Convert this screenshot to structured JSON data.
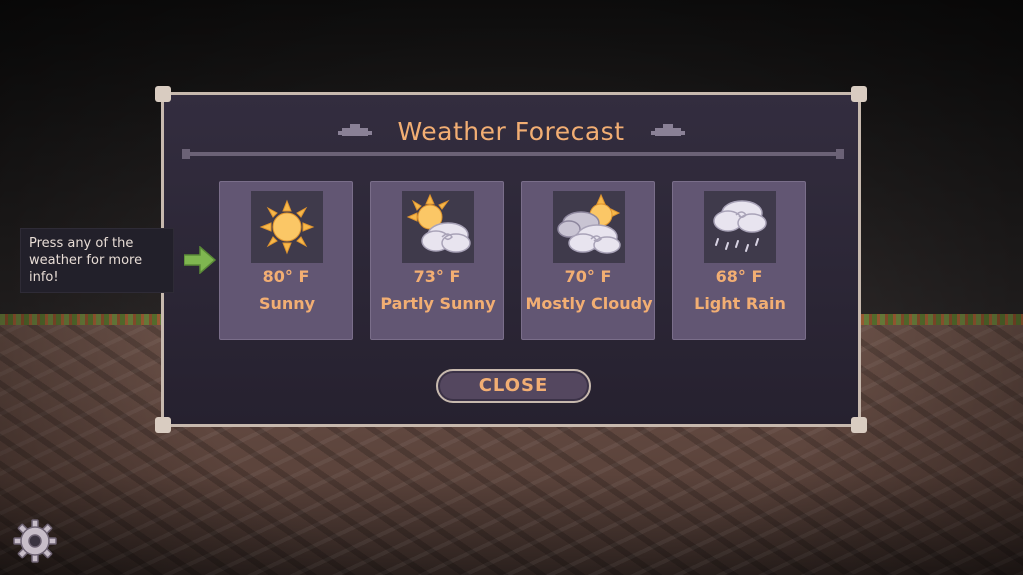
{
  "dialog": {
    "title": "Weather Forecast",
    "close_label": "CLOSE"
  },
  "hint": {
    "text": "Press any of the weather for more info!"
  },
  "forecast": [
    {
      "temp": "80° F",
      "condition": "Sunny",
      "icon": "sun-icon"
    },
    {
      "temp": "73° F",
      "condition": "Partly Sunny",
      "icon": "partly-sunny-icon"
    },
    {
      "temp": "70° F",
      "condition": "Mostly Cloudy",
      "icon": "mostly-cloudy-icon"
    },
    {
      "temp": "68° F",
      "condition": "Light Rain",
      "icon": "light-rain-icon"
    }
  ],
  "colors": {
    "accent_text": "#f2ae73",
    "panel": "#2d2838",
    "card": "#625673",
    "frame": "#c7b9ae",
    "sun": "#f7b84a",
    "cloud": "#e8e4ef"
  },
  "icons": {
    "settings": "gear-icon",
    "hint_arrow": "arrow-right-icon"
  }
}
